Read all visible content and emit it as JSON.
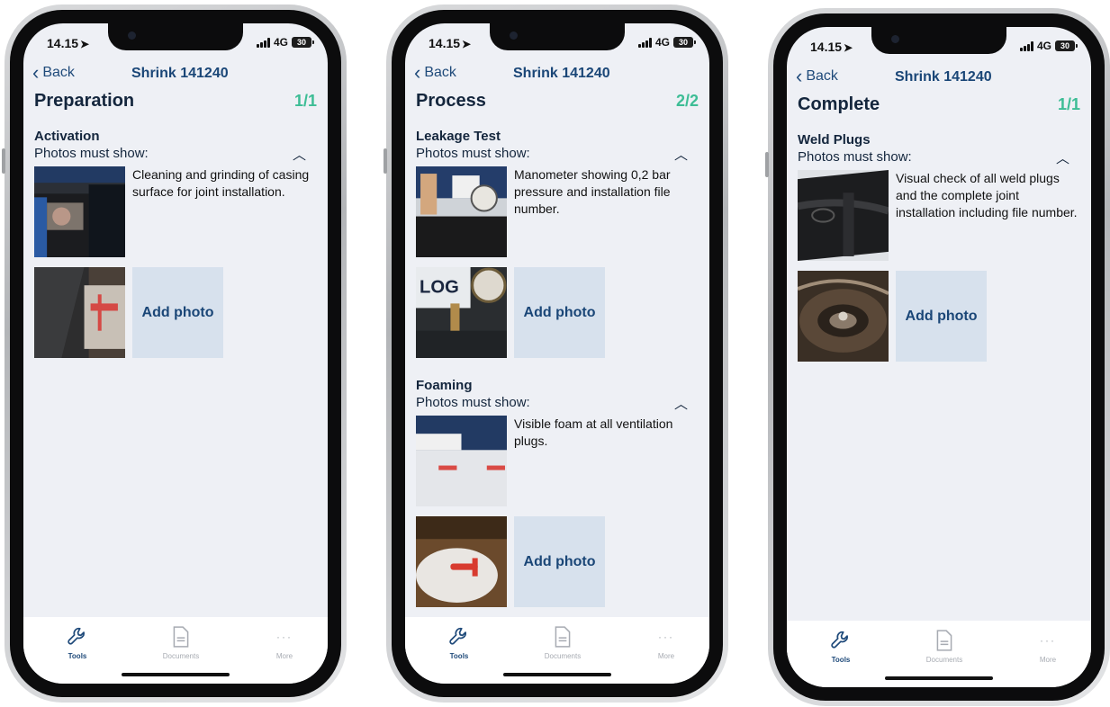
{
  "common": {
    "time": "14.15",
    "network": "4G",
    "battery": "30",
    "back_label": "Back",
    "nav_title": "Shrink 141240",
    "photos_must_show": "Photos must show:",
    "add_photo": "Add photo",
    "tabs": [
      {
        "label": "Tools",
        "icon": "wrench-icon",
        "active": true
      },
      {
        "label": "Documents",
        "icon": "document-icon",
        "active": false
      },
      {
        "label": "More",
        "icon": "more-dots-icon",
        "active": false
      }
    ],
    "colors": {
      "accent": "#1a4677",
      "counter": "#3dbd95",
      "screen_bg": "#eef0f5",
      "add_photo_bg": "#d7e1ed"
    }
  },
  "screens": [
    {
      "title": "Preparation",
      "counter": "1/1",
      "sections": [
        {
          "title": "Activation",
          "description": "Cleaning and grinding of casing surface for joint installation."
        }
      ]
    },
    {
      "title": "Process",
      "counter": "2/2",
      "sections": [
        {
          "title": "Leakage Test",
          "description": "Manometer showing 0,2 bar pressure and installation file number."
        },
        {
          "title": "Foaming",
          "description": "Visible foam at all ventilation plugs."
        }
      ]
    },
    {
      "title": "Complete",
      "counter": "1/1",
      "sections": [
        {
          "title": "Weld Plugs",
          "description": "Visual check of all weld plugs and the complete joint installation including file number."
        }
      ]
    }
  ]
}
